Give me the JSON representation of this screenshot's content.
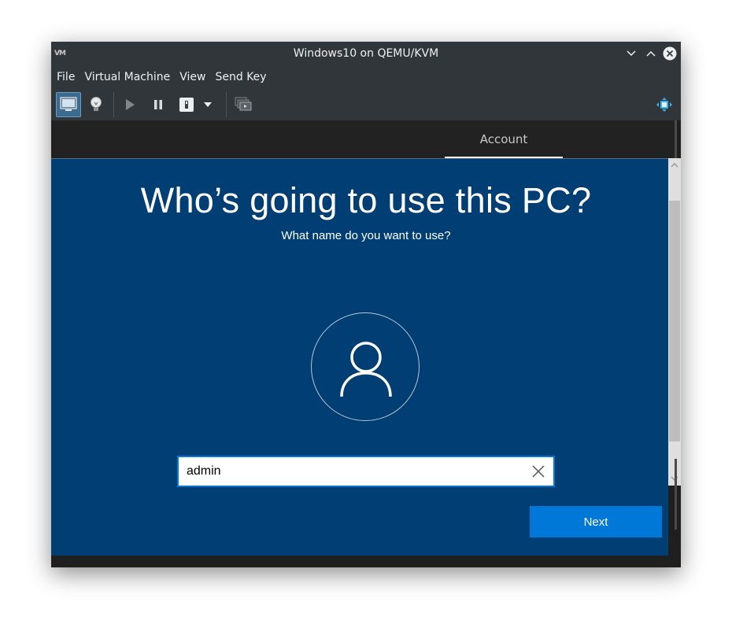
{
  "window": {
    "title": "Windows10 on QEMU/KVM",
    "app_logo_text": "VM"
  },
  "menubar": {
    "items": [
      {
        "label": "File"
      },
      {
        "label": "Virtual Machine"
      },
      {
        "label": "View"
      },
      {
        "label": "Send Key"
      }
    ]
  },
  "toolbar": {
    "buttons": [
      {
        "name": "console-view-icon",
        "active": true
      },
      {
        "name": "details-lightbulb-icon"
      },
      {
        "name": "run-icon"
      },
      {
        "name": "pause-icon"
      },
      {
        "name": "shutdown-icon"
      },
      {
        "name": "shutdown-menu-chevron-icon"
      },
      {
        "name": "snapshots-icon"
      },
      {
        "name": "fullscreen-resize-icon"
      }
    ]
  },
  "oobe": {
    "tab_label": "Account",
    "heading": "Who’s going to use this PC?",
    "subheading": "What name do you want to use?",
    "name_input_value": "admin",
    "next_label": "Next"
  },
  "colors": {
    "oobe_background": "#003e73",
    "accent": "#0078d7",
    "window_chrome": "#31363b"
  }
}
